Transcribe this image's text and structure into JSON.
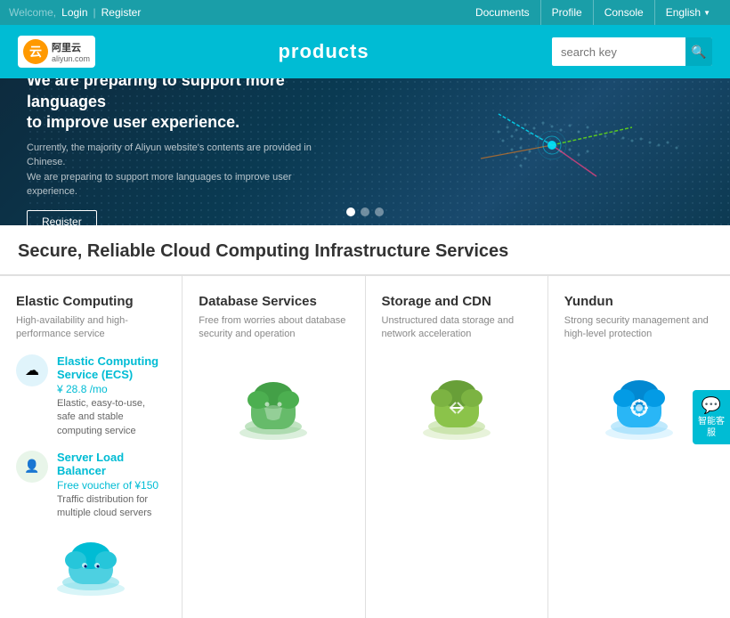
{
  "topbar": {
    "welcome": "Welcome,",
    "login": "Login",
    "register": "Register",
    "nav": [
      "Documents",
      "Profile",
      "Console",
      "English"
    ]
  },
  "header": {
    "title": "products",
    "search_placeholder": "search key",
    "logo_text": "阿里云",
    "logo_sub": "aliyun.com"
  },
  "hero": {
    "title": "We are preparing to support more languages\nto improve user experience.",
    "desc": "Currently, the majority of Aliyun website's contents are provided in Chinese.\nWe are preparing to support more languages to improve user experience.",
    "btn": "Register"
  },
  "support": {
    "label": "智能客服"
  },
  "section": {
    "title": "Secure, Reliable Cloud Computing Infrastructure Services"
  },
  "products": [
    {
      "id": "elastic",
      "title": "Elastic Computing",
      "desc": "High-availability and high-performance service",
      "services": [
        {
          "name": "Elastic Computing Service (ECS)",
          "price": "¥ 28.8 /mo",
          "desc": "Elastic, easy-to-use, safe and stable computing service",
          "icon": "☁",
          "color": "blue"
        },
        {
          "name": "Server Load Balancer",
          "price": "Free voucher of ¥150",
          "desc": "Traffic distribution for multiple cloud servers",
          "icon": "👤",
          "color": "green"
        }
      ],
      "cloud_color": "#4dd0e1",
      "base_color": "#80deea"
    },
    {
      "id": "database",
      "title": "Database Services",
      "desc": "Free from worries about database security and operation",
      "cloud_color": "#66bb6a",
      "base_color": "#a5d6a7"
    },
    {
      "id": "storage",
      "title": "Storage and CDN",
      "desc": "Unstructured data storage and network acceleration",
      "cloud_color": "#8bc34a",
      "base_color": "#c5e1a5"
    },
    {
      "id": "yundun",
      "title": "Yundun",
      "desc": "Strong security management and high-level protection",
      "cloud_color": "#4fc3f7",
      "base_color": "#b3e5fc"
    }
  ]
}
